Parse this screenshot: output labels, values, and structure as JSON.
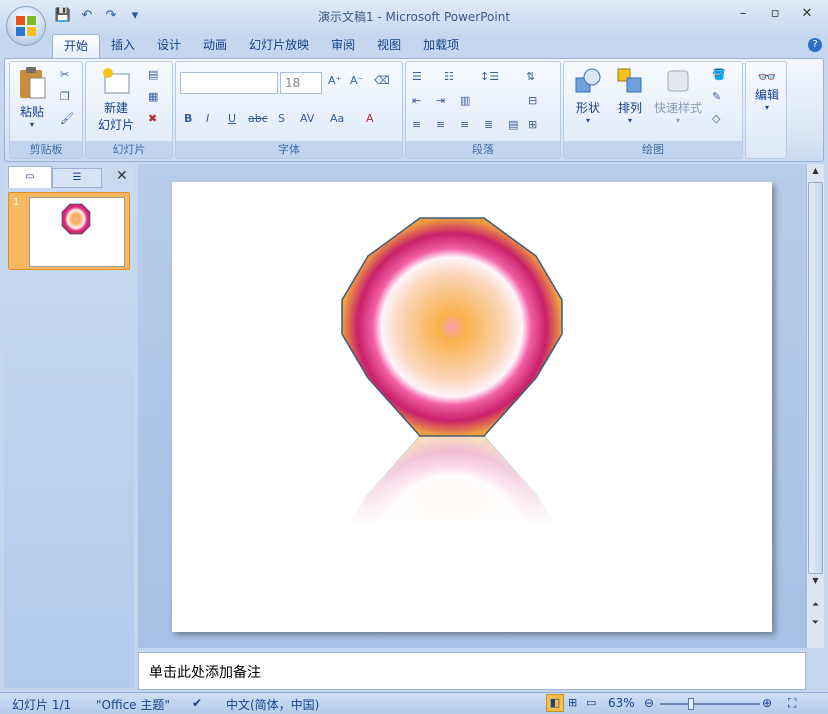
{
  "window": {
    "title": "演示文稿1 - Microsoft PowerPoint"
  },
  "tabs": [
    "开始",
    "插入",
    "设计",
    "动画",
    "幻灯片放映",
    "审阅",
    "视图",
    "加载项"
  ],
  "ribbon": {
    "clipboard": {
      "paste": "粘贴",
      "label": "剪贴板"
    },
    "slides": {
      "new_slide_line1": "新建",
      "new_slide_line2": "幻灯片",
      "label": "幻灯片"
    },
    "font": {
      "size": "18",
      "label": "字体"
    },
    "paragraph": {
      "label": "段落"
    },
    "drawing": {
      "shape": "形状",
      "arrange": "排列",
      "quick_styles": "快速样式",
      "label": "绘图"
    },
    "editing": {
      "label": "编辑"
    }
  },
  "thumbnail": {
    "number": "1"
  },
  "notes": {
    "placeholder": "单击此处添加备注"
  },
  "status": {
    "slide": "幻灯片 1/1",
    "theme": "\"Office 主题\"",
    "language": "中文(简体，中国)",
    "zoom": "63%"
  },
  "colors": {
    "accent": "#2f6fc3",
    "octagon_outer": "#c8206a",
    "octagon_center": "#f9b04a"
  }
}
